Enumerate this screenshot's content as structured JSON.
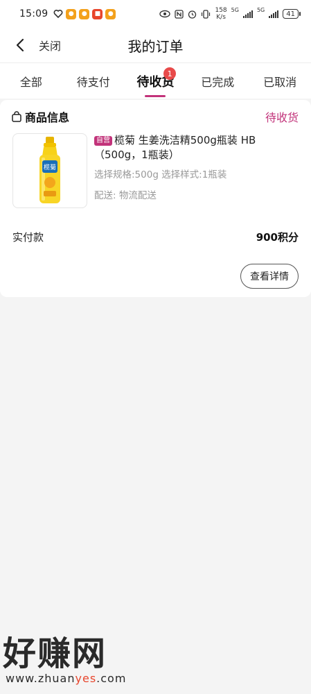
{
  "status_bar": {
    "time": "15:09",
    "speed_value": "158",
    "speed_unit": "K/s",
    "battery": "41",
    "network_1": "5G",
    "network_2": "5G"
  },
  "header": {
    "close_label": "关闭",
    "title": "我的订单"
  },
  "tabs": [
    {
      "label": "全部",
      "active": false
    },
    {
      "label": "待支付",
      "active": false
    },
    {
      "label": "待收货",
      "active": true,
      "badge": "1"
    },
    {
      "label": "已完成",
      "active": false
    },
    {
      "label": "已取消",
      "active": false
    }
  ],
  "order": {
    "section_title": "商品信息",
    "status": "待收货",
    "product": {
      "tag": "自营",
      "name": "榄菊 生姜洗洁精500g瓶装 HB（500g，1瓶装）",
      "spec": "选择规格:500g 选择样式:1瓶装",
      "shipping": "配送: 物流配送",
      "image_label": "榄菊"
    },
    "paid_label": "实付款",
    "paid_value": "900积分",
    "detail_button": "查看详情"
  },
  "watermark": {
    "text": "好赚网",
    "url_prefix": "www.zhuan",
    "url_highlight": "yes",
    "url_suffix": ".com"
  },
  "colors": {
    "accent": "#c2337a",
    "badge": "#e84a4a",
    "muted_text": "#999999"
  }
}
